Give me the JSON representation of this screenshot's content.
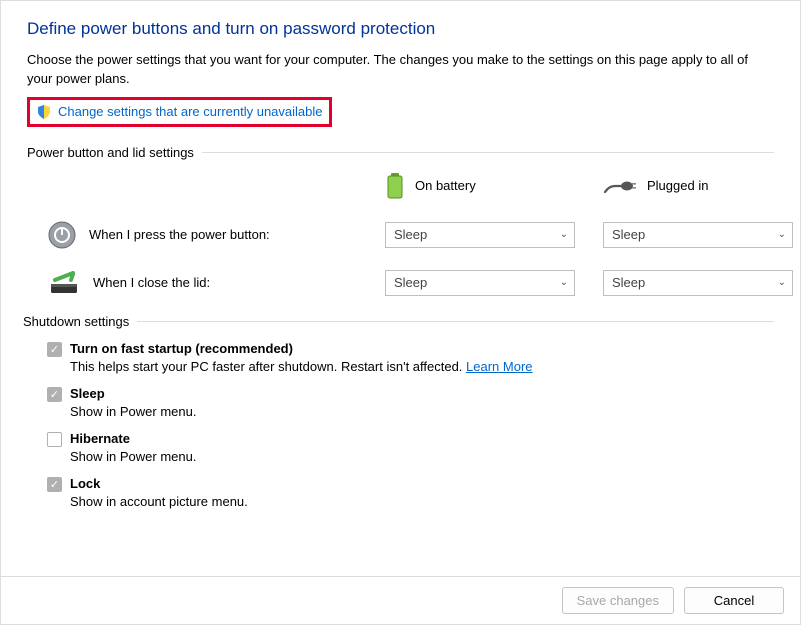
{
  "title": "Define power buttons and turn on password protection",
  "description": "Choose the power settings that you want for your computer. The changes you make to the settings on this page apply to all of your power plans.",
  "change_link": "Change settings that are currently unavailable",
  "section_power": "Power button and lid settings",
  "columns": {
    "battery": "On battery",
    "plugged": "Plugged in"
  },
  "rows": {
    "power_button": {
      "label": "When I press the power button:",
      "battery": "Sleep",
      "plugged": "Sleep"
    },
    "lid": {
      "label": "When I close the lid:",
      "battery": "Sleep",
      "plugged": "Sleep"
    }
  },
  "section_shutdown": "Shutdown settings",
  "shutdown": {
    "fast": {
      "title": "Turn on fast startup (recommended)",
      "sub": "This helps start your PC faster after shutdown. Restart isn't affected. ",
      "learn": "Learn More",
      "checked": true
    },
    "sleep": {
      "title": "Sleep",
      "sub": "Show in Power menu.",
      "checked": true
    },
    "hibernate": {
      "title": "Hibernate",
      "sub": "Show in Power menu.",
      "checked": false
    },
    "lock": {
      "title": "Lock",
      "sub": "Show in account picture menu.",
      "checked": true
    }
  },
  "buttons": {
    "save": "Save changes",
    "cancel": "Cancel"
  }
}
